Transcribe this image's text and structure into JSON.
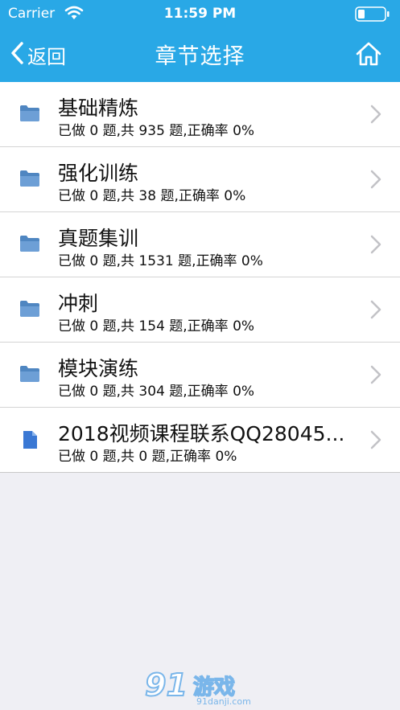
{
  "status_bar": {
    "carrier": "Carrier",
    "time": "11:59 PM"
  },
  "nav": {
    "back_label": "返回",
    "title": "章节选择"
  },
  "colors": {
    "header_bg": "#29a8e6",
    "folder_icon": "#5b8fc7",
    "document_icon": "#3a78d4"
  },
  "chapters": [
    {
      "icon": "folder-icon",
      "title": "基础精炼",
      "subtitle": "已做 0 题,共 935 题,正确率 0%"
    },
    {
      "icon": "folder-icon",
      "title": "强化训练",
      "subtitle": "已做 0 题,共 38 题,正确率 0%"
    },
    {
      "icon": "folder-icon",
      "title": "真题集训",
      "subtitle": "已做 0 题,共 1531 题,正确率 0%"
    },
    {
      "icon": "folder-icon",
      "title": "冲刺",
      "subtitle": "已做 0 题,共 154 题,正确率 0%"
    },
    {
      "icon": "folder-icon",
      "title": "模块演练",
      "subtitle": "已做 0 题,共 304 题,正确率 0%"
    },
    {
      "icon": "document-icon",
      "title": "2018视频课程联系QQ28045...",
      "subtitle": "已做 0 题,共 0 题,正确率 0%"
    }
  ],
  "watermark": {
    "logo": "91",
    "name": "游戏",
    "url": "91danji.com"
  }
}
